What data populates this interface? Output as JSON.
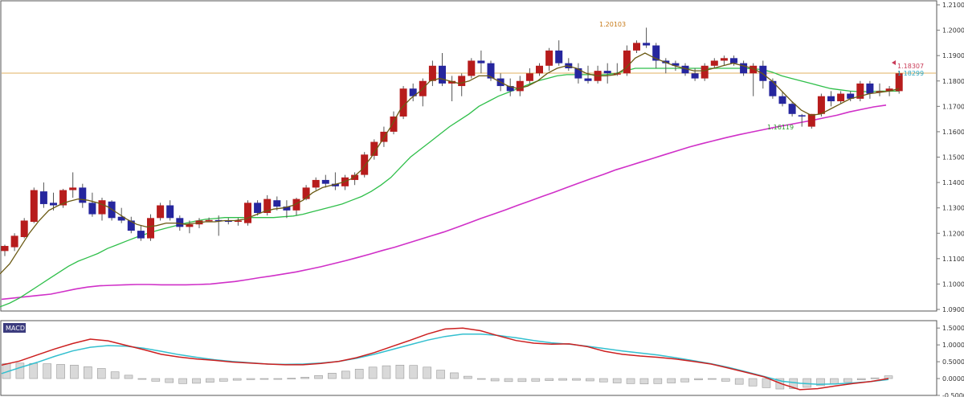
{
  "colors": {
    "bull": "#b71c1c",
    "bear": "#26269e",
    "wick": "#555555",
    "ma_fast": "#6b5a14",
    "ma_mid": "#2fbf4a",
    "ma_slow": "#d030c8",
    "hline": "#e0b060",
    "macd": "#cc1f1f",
    "signal": "#33bfcf",
    "hist_fill": "#d9d9d9",
    "hist_stroke": "#9a9a9a",
    "price_label_1": "#c93a57",
    "price_label_2": "#2aa7c0",
    "annot_high": "#c77a18",
    "annot_low": "#2f9a2f",
    "macd_tag_bg": "#3c3c7e",
    "macd_tag_text": "#ffffff",
    "frame": "#555555"
  },
  "main_axis_labels": [
    "1.21000",
    "1.20000",
    "1.19000",
    "1.18000",
    "1.17000",
    "1.16000",
    "1.15000",
    "1.14000",
    "1.13000",
    "1.12000",
    "1.11000",
    "1.10000",
    "1.09000"
  ],
  "macd_axis_labels": [
    "1.5000",
    "1.0000",
    "0.5000",
    "0.0000",
    "-0.5000"
  ],
  "macd_tag": "MACD",
  "annotations": {
    "high_label": "1.20103",
    "low_label": "1.16119",
    "price_label_1": "1.18307",
    "price_label_2": "1.18299"
  },
  "chart_data": [
    {
      "type": "candlestick",
      "ylim": [
        1.09,
        1.21
      ],
      "horizontal_line": 1.18307,
      "candles": [
        [
          1.113,
          1.1155,
          1.111,
          1.115
        ],
        [
          1.1145,
          1.12,
          1.113,
          1.119
        ],
        [
          1.1185,
          1.126,
          1.118,
          1.125
        ],
        [
          1.1245,
          1.138,
          1.124,
          1.137
        ],
        [
          1.1365,
          1.14,
          1.13,
          1.1315
        ],
        [
          1.132,
          1.136,
          1.129,
          1.131
        ],
        [
          1.131,
          1.1375,
          1.13,
          1.137
        ],
        [
          1.137,
          1.144,
          1.134,
          1.138
        ],
        [
          1.138,
          1.1395,
          1.13,
          1.132
        ],
        [
          1.132,
          1.136,
          1.1265,
          1.1275
        ],
        [
          1.1275,
          1.134,
          1.125,
          1.133
        ],
        [
          1.1325,
          1.133,
          1.125,
          1.126
        ],
        [
          1.1265,
          1.13,
          1.124,
          1.125
        ],
        [
          1.125,
          1.1265,
          1.12,
          1.121
        ],
        [
          1.121,
          1.123,
          1.117,
          1.118
        ],
        [
          1.118,
          1.1275,
          1.117,
          1.126
        ],
        [
          1.126,
          1.132,
          1.125,
          1.131
        ],
        [
          1.131,
          1.133,
          1.125,
          1.126
        ],
        [
          1.126,
          1.127,
          1.121,
          1.1225
        ],
        [
          1.1225,
          1.125,
          1.12,
          1.1235
        ],
        [
          1.1235,
          1.126,
          1.122,
          1.125
        ],
        [
          1.125,
          1.1262,
          1.1248,
          1.1252
        ],
        [
          1.1252,
          1.127,
          1.119,
          1.125
        ],
        [
          1.125,
          1.126,
          1.1235,
          1.1245
        ],
        [
          1.1245,
          1.126,
          1.123,
          1.125
        ],
        [
          1.124,
          1.133,
          1.123,
          1.132
        ],
        [
          1.132,
          1.133,
          1.127,
          1.128
        ],
        [
          1.128,
          1.135,
          1.127,
          1.1335
        ],
        [
          1.133,
          1.1345,
          1.129,
          1.1305
        ],
        [
          1.1305,
          1.133,
          1.126,
          1.129
        ],
        [
          1.129,
          1.134,
          1.127,
          1.1335
        ],
        [
          1.1335,
          1.139,
          1.133,
          1.138
        ],
        [
          1.138,
          1.142,
          1.137,
          1.141
        ],
        [
          1.141,
          1.143,
          1.138,
          1.1395
        ],
        [
          1.1395,
          1.144,
          1.137,
          1.1385
        ],
        [
          1.1385,
          1.143,
          1.137,
          1.142
        ],
        [
          1.141,
          1.144,
          1.139,
          1.143
        ],
        [
          1.143,
          1.152,
          1.142,
          1.151
        ],
        [
          1.1505,
          1.157,
          1.149,
          1.156
        ],
        [
          1.156,
          1.162,
          1.154,
          1.16
        ],
        [
          1.16,
          1.168,
          1.159,
          1.166
        ],
        [
          1.166,
          1.178,
          1.165,
          1.177
        ],
        [
          1.177,
          1.179,
          1.172,
          1.174
        ],
        [
          1.174,
          1.181,
          1.17,
          1.18
        ],
        [
          1.18,
          1.188,
          1.178,
          1.186
        ],
        [
          1.186,
          1.191,
          1.178,
          1.179
        ],
        [
          1.179,
          1.182,
          1.172,
          1.18
        ],
        [
          1.178,
          1.183,
          1.174,
          1.182
        ],
        [
          1.182,
          1.189,
          1.181,
          1.188
        ],
        [
          1.188,
          1.192,
          1.183,
          1.187
        ],
        [
          1.187,
          1.188,
          1.18,
          1.181
        ],
        [
          1.181,
          1.183,
          1.176,
          1.178
        ],
        [
          1.178,
          1.181,
          1.174,
          1.176
        ],
        [
          1.176,
          1.182,
          1.174,
          1.18
        ],
        [
          1.18,
          1.185,
          1.179,
          1.183
        ],
        [
          1.183,
          1.187,
          1.182,
          1.186
        ],
        [
          1.186,
          1.193,
          1.184,
          1.192
        ],
        [
          1.192,
          1.196,
          1.186,
          1.187
        ],
        [
          1.187,
          1.189,
          1.184,
          1.185
        ],
        [
          1.185,
          1.187,
          1.179,
          1.181
        ],
        [
          1.181,
          1.186,
          1.179,
          1.18
        ],
        [
          1.18,
          1.186,
          1.179,
          1.184
        ],
        [
          1.184,
          1.187,
          1.179,
          1.183
        ],
        [
          1.183,
          1.187,
          1.182,
          1.183
        ],
        [
          1.183,
          1.194,
          1.182,
          1.192
        ],
        [
          1.192,
          1.196,
          1.191,
          1.195
        ],
        [
          1.195,
          1.201,
          1.193,
          1.194
        ],
        [
          1.194,
          1.195,
          1.185,
          1.188
        ],
        [
          1.188,
          1.189,
          1.183,
          1.187
        ],
        [
          1.187,
          1.188,
          1.184,
          1.186
        ],
        [
          1.186,
          1.187,
          1.182,
          1.183
        ],
        [
          1.183,
          1.185,
          1.18,
          1.181
        ],
        [
          1.181,
          1.187,
          1.18,
          1.186
        ],
        [
          1.186,
          1.189,
          1.185,
          1.188
        ],
        [
          1.188,
          1.19,
          1.186,
          1.189
        ],
        [
          1.189,
          1.19,
          1.186,
          1.187
        ],
        [
          1.187,
          1.188,
          1.182,
          1.183
        ],
        [
          1.183,
          1.187,
          1.174,
          1.186
        ],
        [
          1.186,
          1.188,
          1.177,
          1.18
        ],
        [
          1.18,
          1.181,
          1.173,
          1.174
        ],
        [
          1.174,
          1.176,
          1.17,
          1.171
        ],
        [
          1.171,
          1.172,
          1.166,
          1.167
        ],
        [
          1.1665,
          1.167,
          1.162,
          1.166
        ],
        [
          1.162,
          1.167,
          1.1612,
          1.167
        ],
        [
          1.167,
          1.175,
          1.166,
          1.174
        ],
        [
          1.174,
          1.176,
          1.17,
          1.172
        ],
        [
          1.172,
          1.176,
          1.171,
          1.175
        ],
        [
          1.175,
          1.176,
          1.172,
          1.173
        ],
        [
          1.173,
          1.18,
          1.172,
          1.179
        ],
        [
          1.179,
          1.18,
          1.173,
          1.175
        ],
        [
          1.176,
          1.179,
          1.174,
          1.176
        ],
        [
          1.176,
          1.178,
          1.174,
          1.177
        ],
        [
          1.176,
          1.184,
          1.175,
          1.183
        ]
      ],
      "ma_fast": [
        1.104,
        1.108,
        1.114,
        1.12,
        1.125,
        1.129,
        1.131,
        1.1325,
        1.1335,
        1.133,
        1.132,
        1.1305,
        1.128,
        1.1255,
        1.1235,
        1.1225,
        1.123,
        1.124,
        1.124,
        1.1235,
        1.124,
        1.1245,
        1.1245,
        1.125,
        1.125,
        1.1255,
        1.127,
        1.1285,
        1.1295,
        1.13,
        1.131,
        1.133,
        1.136,
        1.138,
        1.139,
        1.14,
        1.1415,
        1.145,
        1.15,
        1.156,
        1.162,
        1.169,
        1.173,
        1.176,
        1.18,
        1.181,
        1.18,
        1.179,
        1.18,
        1.182,
        1.182,
        1.18,
        1.178,
        1.177,
        1.178,
        1.18,
        1.183,
        1.185,
        1.186,
        1.185,
        1.183,
        1.182,
        1.182,
        1.1825,
        1.185,
        1.189,
        1.191,
        1.189,
        1.1875,
        1.186,
        1.185,
        1.184,
        1.184,
        1.185,
        1.186,
        1.187,
        1.186,
        1.185,
        1.183,
        1.18,
        1.176,
        1.172,
        1.1685,
        1.1665,
        1.167,
        1.169,
        1.171,
        1.173,
        1.174,
        1.175,
        1.1755,
        1.176,
        1.177
      ],
      "ma_mid": [
        1.091,
        1.0925,
        1.0945,
        1.097,
        1.0995,
        1.102,
        1.1045,
        1.107,
        1.109,
        1.1105,
        1.112,
        1.114,
        1.1155,
        1.117,
        1.1185,
        1.1198,
        1.121,
        1.122,
        1.123,
        1.124,
        1.1248,
        1.1255,
        1.1258,
        1.1262,
        1.1262,
        1.1262,
        1.1262,
        1.1262,
        1.1262,
        1.1265,
        1.1268,
        1.1275,
        1.1285,
        1.1295,
        1.1305,
        1.1315,
        1.133,
        1.1345,
        1.1365,
        1.139,
        1.142,
        1.146,
        1.15,
        1.153,
        1.156,
        1.159,
        1.162,
        1.1645,
        1.167,
        1.17,
        1.172,
        1.174,
        1.1755,
        1.177,
        1.1785,
        1.18,
        1.181,
        1.182,
        1.1825,
        1.1825,
        1.1825,
        1.1825,
        1.1825,
        1.183,
        1.184,
        1.185,
        1.185,
        1.185,
        1.185,
        1.185,
        1.185,
        1.185,
        1.185,
        1.185,
        1.185,
        1.185,
        1.185,
        1.1848,
        1.1845,
        1.1835,
        1.182,
        1.181,
        1.18,
        1.179,
        1.178,
        1.177,
        1.1765,
        1.176,
        1.1758,
        1.1758,
        1.176,
        1.176,
        1.176
      ],
      "ma_slow": [
        1.094,
        1.0945,
        1.095,
        1.0955,
        1.096,
        1.097,
        1.098,
        1.0988,
        1.0993,
        1.0995,
        1.0997,
        1.0998,
        1.0998,
        1.0997,
        1.0997,
        1.0997,
        1.0998,
        1.1,
        1.1005,
        1.101,
        1.1017,
        1.1025,
        1.1032,
        1.104,
        1.1048,
        1.1058,
        1.1068,
        1.108,
        1.1092,
        1.1105,
        1.1118,
        1.1132,
        1.1145,
        1.116,
        1.1175,
        1.119,
        1.1205,
        1.1222,
        1.124,
        1.1258,
        1.1275,
        1.1292,
        1.131,
        1.1327,
        1.1345,
        1.1362,
        1.138,
        1.1398,
        1.1415,
        1.1432,
        1.145,
        1.1465,
        1.148,
        1.1495,
        1.151,
        1.1525,
        1.154,
        1.1553,
        1.1565,
        1.1577,
        1.1588,
        1.1598,
        1.1608,
        1.1618,
        1.1627,
        1.1636,
        1.1645,
        1.1655,
        1.1665,
        1.1678,
        1.1688,
        1.1698,
        1.1705
      ],
      "ma_slow_start_index": 0,
      "ma_slow_step": 1.3
    },
    {
      "type": "macd",
      "ylim": [
        -0.5,
        1.6
      ],
      "macd": [
        0.4,
        0.52,
        0.7,
        0.88,
        1.04,
        1.17,
        1.12,
        0.99,
        0.86,
        0.72,
        0.64,
        0.58,
        0.54,
        0.49,
        0.46,
        0.43,
        0.41,
        0.41,
        0.45,
        0.51,
        0.62,
        0.77,
        0.95,
        1.13,
        1.32,
        1.47,
        1.5,
        1.42,
        1.27,
        1.13,
        1.05,
        1.02,
        1.03,
        0.95,
        0.81,
        0.72,
        0.67,
        0.63,
        0.58,
        0.51,
        0.43,
        0.31,
        0.18,
        0.05,
        -0.16,
        -0.33,
        -0.3,
        -0.22,
        -0.15,
        -0.09,
        0.0
      ],
      "signal": [
        0.15,
        0.32,
        0.48,
        0.66,
        0.82,
        0.93,
        0.98,
        0.96,
        0.9,
        0.81,
        0.71,
        0.63,
        0.56,
        0.51,
        0.47,
        0.43,
        0.42,
        0.43,
        0.46,
        0.51,
        0.6,
        0.72,
        0.86,
        1.0,
        1.14,
        1.25,
        1.32,
        1.32,
        1.28,
        1.21,
        1.13,
        1.06,
        1.02,
        0.96,
        0.89,
        0.82,
        0.76,
        0.7,
        0.62,
        0.53,
        0.44,
        0.33,
        0.2,
        0.06,
        -0.08,
        -0.14,
        -0.17,
        -0.16,
        -0.13,
        -0.09,
        -0.03
      ],
      "histogram": [
        0.45,
        0.46,
        0.45,
        0.44,
        0.42,
        0.4,
        0.35,
        0.3,
        0.2,
        0.1,
        -0.02,
        -0.08,
        -0.12,
        -0.15,
        -0.14,
        -0.11,
        -0.08,
        -0.05,
        -0.03,
        -0.02,
        -0.01,
        0.01,
        0.04,
        0.09,
        0.16,
        0.22,
        0.28,
        0.34,
        0.38,
        0.4,
        0.39,
        0.34,
        0.25,
        0.17,
        0.07,
        -0.01,
        -0.07,
        -0.09,
        -0.09,
        -0.08,
        -0.06,
        -0.05,
        -0.05,
        -0.07,
        -0.1,
        -0.13,
        -0.15,
        -0.16,
        -0.15,
        -0.13,
        -0.1,
        -0.04,
        -0.02,
        -0.08,
        -0.17,
        -0.22,
        -0.27,
        -0.31,
        -0.3,
        -0.26,
        -0.21,
        -0.16,
        -0.1,
        -0.04,
        0.02,
        0.08
      ]
    }
  ]
}
